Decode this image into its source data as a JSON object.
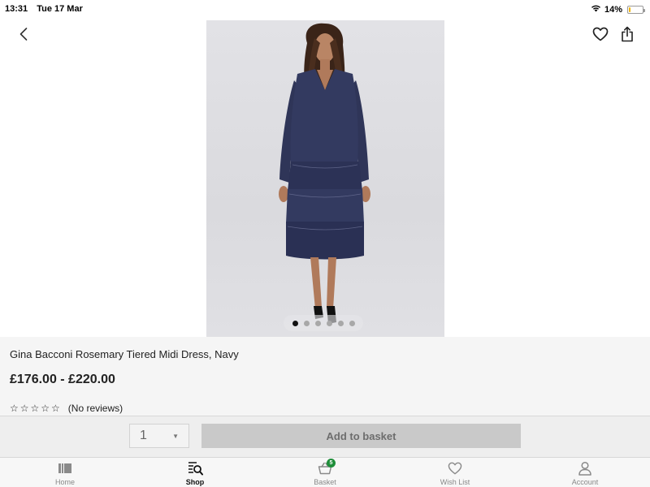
{
  "status_bar": {
    "time": "13:31",
    "date": "Tue 17 Mar",
    "battery": "14%",
    "battery_level": 0.14,
    "wifi_icon": "wifi-icon",
    "battery_icon": "battery-icon"
  },
  "header": {
    "back_icon": "chevron-left-icon",
    "wishlist_icon": "heart-icon",
    "share_icon": "share-icon"
  },
  "gallery": {
    "image_count": 6,
    "active_index": 0
  },
  "product": {
    "title": "Gina Bacconi Rosemary Tiered Midi Dress, Navy",
    "price": "£176.00 - £220.00",
    "stars": "☆☆☆☆☆",
    "reviews": "(No reviews)"
  },
  "purchase": {
    "quantity": "1",
    "add_to_basket": "Add to basket"
  },
  "tab_bar": {
    "tabs": [
      {
        "label": "Home",
        "icon": "home-icon",
        "active": false
      },
      {
        "label": "Shop",
        "icon": "shop-search-icon",
        "active": true
      },
      {
        "label": "Basket",
        "icon": "basket-icon",
        "active": false,
        "badge": "5"
      },
      {
        "label": "Wish List",
        "icon": "heart-icon",
        "active": false
      },
      {
        "label": "Account",
        "icon": "account-icon",
        "active": false
      }
    ]
  },
  "colors": {
    "badge": "#1f8e3a",
    "dress": "#2f3558",
    "active_dot": "#111111"
  }
}
